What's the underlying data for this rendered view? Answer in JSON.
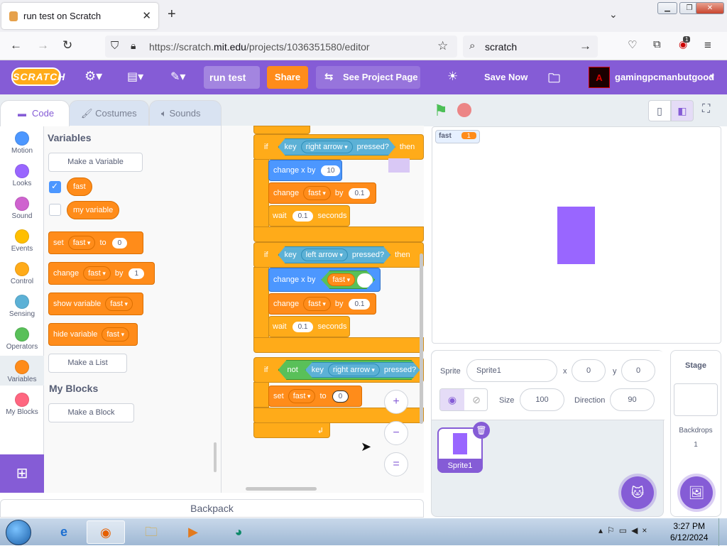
{
  "browser": {
    "tab_title": "run test on Scratch",
    "url_prefix": "https://scratch.",
    "url_domain": "mit.edu",
    "url_path": "/projects/1036351580/editor",
    "search_text": "scratch",
    "extension_badge": "1"
  },
  "menubar": {
    "logo": "SCRATCH",
    "project_title": "run test",
    "share": "Share",
    "see_project_page": "See Project Page",
    "save_now": "Save Now",
    "username": "gamingpcmanbutgood"
  },
  "tabs": {
    "code": "Code",
    "costumes": "Costumes",
    "sounds": "Sounds"
  },
  "categories": [
    {
      "label": "Motion",
      "color": "#4c97ff"
    },
    {
      "label": "Looks",
      "color": "#9966ff"
    },
    {
      "label": "Sound",
      "color": "#cf63cf"
    },
    {
      "label": "Events",
      "color": "#ffbf00"
    },
    {
      "label": "Control",
      "color": "#ffab19"
    },
    {
      "label": "Sensing",
      "color": "#5cb1d6"
    },
    {
      "label": "Operators",
      "color": "#59c059"
    },
    {
      "label": "Variables",
      "color": "#ff8c1a"
    },
    {
      "label": "My Blocks",
      "color": "#ff6680"
    }
  ],
  "palette": {
    "variables_header": "Variables",
    "make_variable": "Make a Variable",
    "var_fast": "fast",
    "var_my_variable": "my variable",
    "set_block": {
      "label": "set",
      "var": "fast",
      "to": "to",
      "value": "0"
    },
    "change_block": {
      "label": "change",
      "var": "fast",
      "by": "by",
      "value": "1"
    },
    "show_block": {
      "label": "show variable",
      "var": "fast"
    },
    "hide_block": {
      "label": "hide variable",
      "var": "fast"
    },
    "make_list": "Make a List",
    "myblocks_header": "My Blocks",
    "make_block": "Make a Block"
  },
  "script": {
    "if1": {
      "if": "if",
      "key": "key",
      "key_value": "right arrow",
      "pressed": "pressed?",
      "then": "then"
    },
    "change_x1": {
      "label": "change x by",
      "value": "10"
    },
    "change_fast1": {
      "label": "change",
      "var": "fast",
      "by": "by",
      "value": "0.1"
    },
    "wait1": {
      "label": "wait",
      "value": "0.1",
      "unit": "seconds"
    },
    "if2": {
      "if": "if",
      "key": "key",
      "key_value": "left arrow",
      "pressed": "pressed?",
      "then": "then"
    },
    "change_x2": {
      "label": "change x by",
      "var": "fast",
      "op": "-"
    },
    "change_fast2": {
      "label": "change",
      "var": "fast",
      "by": "by",
      "value": "0.1"
    },
    "wait2": {
      "label": "wait",
      "value": "0.1",
      "unit": "seconds"
    },
    "if3": {
      "if": "if",
      "not": "not",
      "key": "key",
      "key_value": "right arrow",
      "pressed": "pressed?"
    },
    "set_fast": {
      "label": "set",
      "var": "fast",
      "to": "to",
      "value": "0"
    }
  },
  "zoom": {
    "in": "+",
    "out": "−",
    "reset": "="
  },
  "backpack": "Backpack",
  "stage": {
    "monitor_label": "fast",
    "monitor_value": "1"
  },
  "sprite_info": {
    "sprite_label": "Sprite",
    "sprite_name": "Sprite1",
    "x_label": "x",
    "x_value": "0",
    "y_label": "y",
    "y_value": "0",
    "show_label": "Show",
    "size_label": "Size",
    "size_value": "100",
    "direction_label": "Direction",
    "direction_value": "90"
  },
  "sprite_thumb": "Sprite1",
  "stage_pane": {
    "title": "Stage",
    "backdrops_label": "Backdrops",
    "backdrops_count": "1"
  },
  "taskbar": {
    "time": "3:27 PM",
    "date": "6/12/2024"
  }
}
